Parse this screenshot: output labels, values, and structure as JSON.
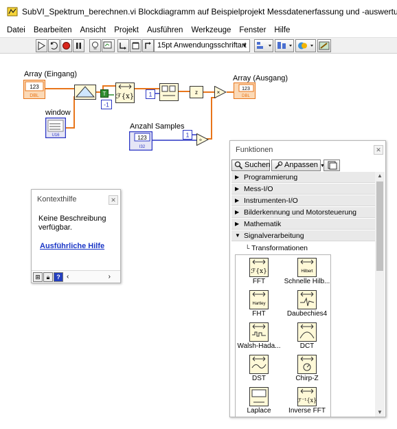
{
  "window": {
    "title": "SubVI_Spektrum_berechnen.vi Blockdiagramm auf Beispielprojekt Messdatenerfassung und -auswertung.lvproj/Mein Comput"
  },
  "menu": {
    "items": [
      "Datei",
      "Bearbeiten",
      "Ansicht",
      "Projekt",
      "Ausführen",
      "Werkzeuge",
      "Fenster",
      "Hilfe"
    ]
  },
  "toolbar": {
    "font_selector": "15pt Anwendungsschriftart"
  },
  "diagram": {
    "labels": {
      "array_in": "Array (Eingang)",
      "window": "window",
      "anzahl_samples": "Anzahl Samples",
      "array_out": "Array (Ausgang)"
    },
    "constants": {
      "c1a": "1",
      "c1b": "1",
      "cneg1": "-1",
      "c123a": "123",
      "c123b": "123",
      "c123c": "123"
    }
  },
  "context_help": {
    "title": "Kontexthilfe",
    "body": "Keine Beschreibung verfügbar.",
    "link": "Ausführliche Hilfe"
  },
  "functions_palette": {
    "title": "Funktionen",
    "search_label": "Suchen",
    "customize_label": "Anpassen",
    "categories": [
      "Programmierung",
      "Mess-I/O",
      "Instrumenten-I/O",
      "Bilderkennung und Motorsteuerung",
      "Mathematik",
      "Signalverarbeitung"
    ],
    "subcategory": "Transformationen",
    "items": [
      {
        "label": "FFT",
        "icon_text": "ℱ{x}"
      },
      {
        "label": "Schnelle Hilb...",
        "icon_text": "Hilbert"
      },
      {
        "label": "FHT",
        "icon_text": "Hartley"
      },
      {
        "label": "Daubechies4",
        "icon_text": ""
      },
      {
        "label": "Walsh-Hada...",
        "icon_text": ""
      },
      {
        "label": "DCT",
        "icon_text": ""
      },
      {
        "label": "DST",
        "icon_text": ""
      },
      {
        "label": "Chirp-Z",
        "icon_text": ""
      },
      {
        "label": "Laplace",
        "icon_text": ""
      },
      {
        "label": "Inverse FFT",
        "icon_text": "ℱ⁻¹{x}"
      }
    ]
  }
}
